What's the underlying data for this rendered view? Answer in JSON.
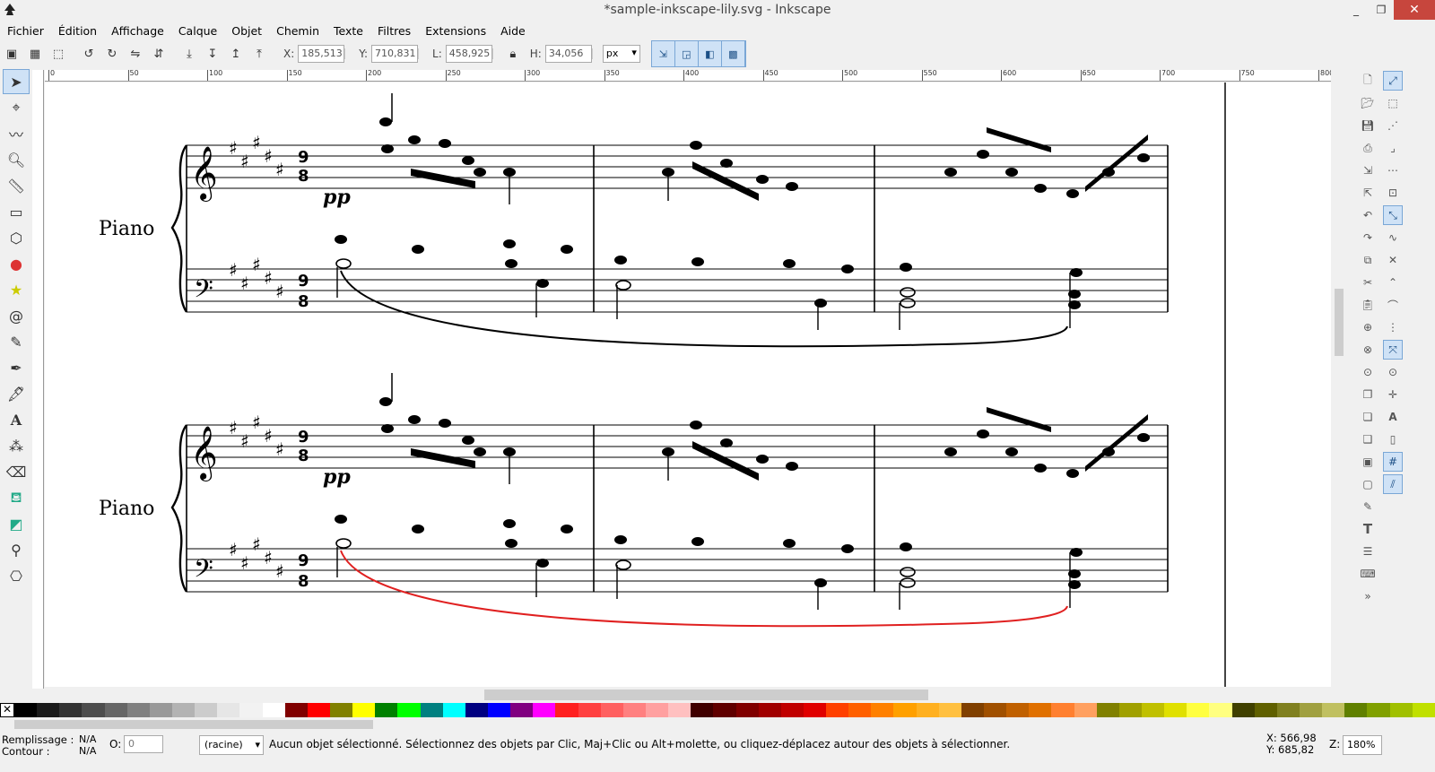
{
  "window": {
    "title": "*sample-inkscape-lily.svg - Inkscape",
    "minimize": "_",
    "restore": "❐",
    "close": "✕"
  },
  "menu": [
    "Fichier",
    "Édition",
    "Affichage",
    "Calque",
    "Objet",
    "Chemin",
    "Texte",
    "Filtres",
    "Extensions",
    "Aide"
  ],
  "toolbar": {
    "x_label": "X:",
    "x_value": "185,513",
    "y_label": "Y:",
    "y_value": "710,831",
    "w_label": "L:",
    "w_value": "458,925",
    "h_label": "H:",
    "h_value": "34,056",
    "unit": "px"
  },
  "ruler_labels": [
    "0",
    "50",
    "100",
    "150",
    "200",
    "250",
    "300",
    "350",
    "400",
    "450",
    "500",
    "550",
    "600",
    "650",
    "700",
    "750",
    "800"
  ],
  "score": {
    "instrument": "Piano",
    "dynamic": "pp",
    "time_sig_top": "9",
    "time_sig_bottom": "8",
    "lower_slur_color": "#e02020"
  },
  "palette": [
    "#000000",
    "#1a1a1a",
    "#333333",
    "#4d4d4d",
    "#666666",
    "#808080",
    "#999999",
    "#b3b3b3",
    "#cccccc",
    "#e6e6e6",
    "#f2f2f2",
    "#ffffff",
    "#800000",
    "#ff0000",
    "#808000",
    "#ffff00",
    "#008000",
    "#00ff00",
    "#008080",
    "#00ffff",
    "#000080",
    "#0000ff",
    "#800080",
    "#ff00ff",
    "#ff2020",
    "#ff4040",
    "#ff6060",
    "#ff8080",
    "#ffa0a0",
    "#ffc0c0",
    "#400000",
    "#600000",
    "#800000",
    "#a00000",
    "#c00000",
    "#e00000",
    "#ff4000",
    "#ff6000",
    "#ff8000",
    "#ffa000",
    "#ffb020",
    "#ffc040",
    "#804000",
    "#a05000",
    "#c06000",
    "#e07000",
    "#ff8030",
    "#ffa060",
    "#808000",
    "#a0a000",
    "#c0c000",
    "#e0e000",
    "#ffff40",
    "#ffff80",
    "#404000",
    "#606000",
    "#808020",
    "#a0a040",
    "#c0c060",
    "#608000",
    "#80a000",
    "#a0c000",
    "#c0e000"
  ],
  "status": {
    "fill_label": "Remplissage :",
    "fill_value": "N/A",
    "stroke_label": "Contour :",
    "stroke_value": "N/A",
    "opacity_label": "O:",
    "opacity_value": "0",
    "layer": "(racine)",
    "message": "Aucun objet sélectionné. Sélectionnez des objets par Clic, Maj+Clic ou Alt+molette, ou cliquez-déplacez autour des objets à sélectionner.",
    "coord_x": "X:  566,98",
    "coord_y": "Y:  685,82",
    "zoom_label": "Z:",
    "zoom_value": "180%"
  }
}
